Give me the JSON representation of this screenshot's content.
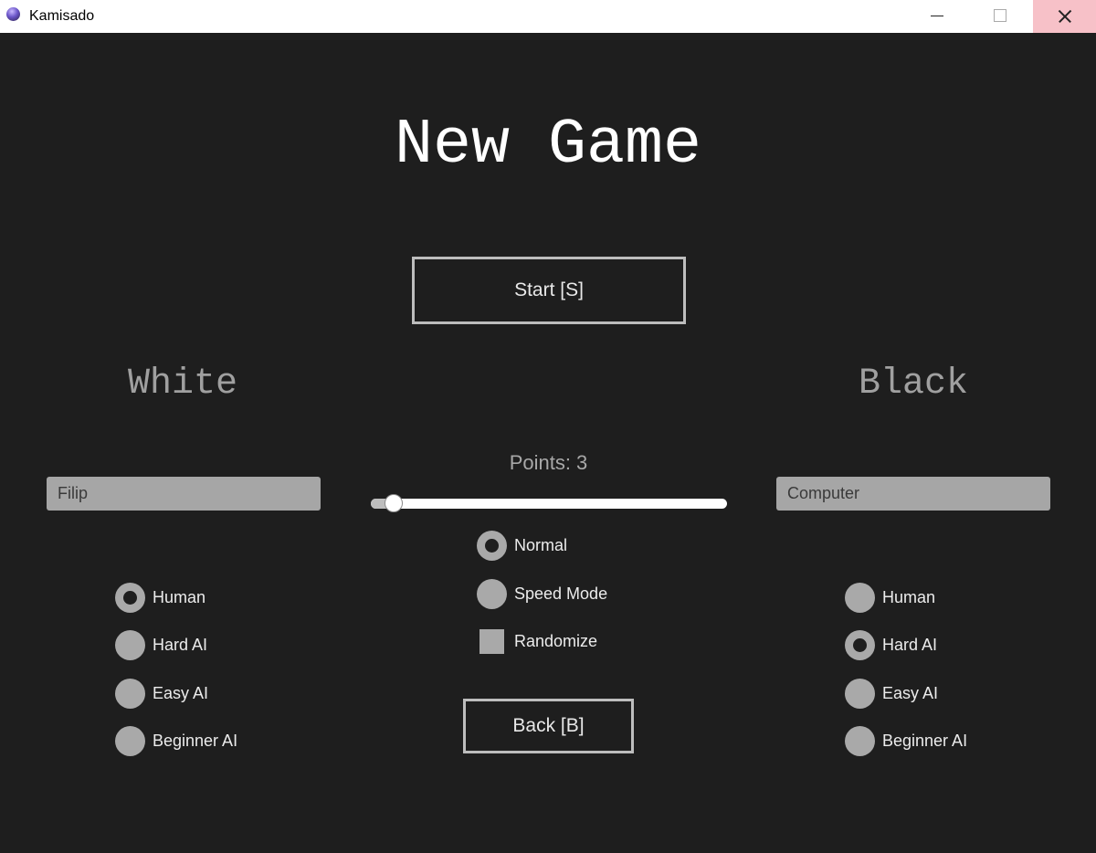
{
  "window": {
    "title": "Kamisado"
  },
  "page": {
    "title": "New Game",
    "start_button": "Start [S]",
    "back_button": "Back [B]"
  },
  "white": {
    "heading": "White",
    "name": "Filip",
    "options": [
      {
        "label": "Human",
        "selected": true
      },
      {
        "label": "Hard AI",
        "selected": false
      },
      {
        "label": "Easy AI",
        "selected": false
      },
      {
        "label": "Beginner AI",
        "selected": false
      }
    ]
  },
  "black": {
    "heading": "Black",
    "name": "Computer",
    "options": [
      {
        "label": "Human",
        "selected": false
      },
      {
        "label": "Hard AI",
        "selected": true
      },
      {
        "label": "Easy AI",
        "selected": false
      },
      {
        "label": "Beginner AI",
        "selected": false
      }
    ]
  },
  "settings": {
    "points_label": "Points: 3",
    "points_value": 3,
    "points_slider_fraction": 0.065,
    "modes": [
      {
        "label": "Normal",
        "selected": true
      },
      {
        "label": "Speed Mode",
        "selected": false
      }
    ],
    "randomize": {
      "label": "Randomize",
      "checked": false
    }
  },
  "colors": {
    "background": "#1e1e1e",
    "control_gray": "#a9a9a9",
    "heading_gray": "#a0a0a0"
  }
}
